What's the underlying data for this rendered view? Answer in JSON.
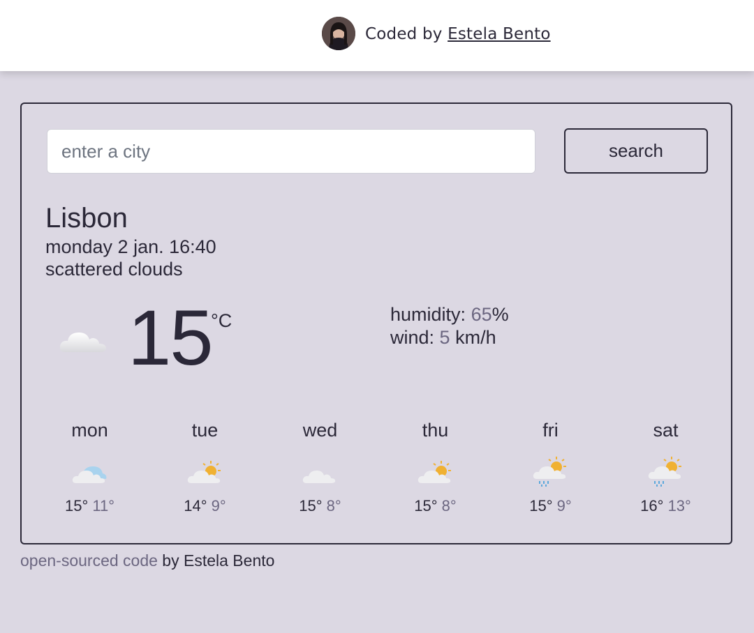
{
  "header": {
    "credit_prefix": "Coded by",
    "author_link": "Estela Bento"
  },
  "search": {
    "placeholder": "enter a city",
    "button_label": "search"
  },
  "current": {
    "city": "Lisbon",
    "date": "monday 2 jan. 16:40",
    "description": "scattered clouds",
    "icon": "cloud-icon",
    "temperature": "15",
    "unit": "°C",
    "humidity_label": "humidity:",
    "humidity_value": "65",
    "humidity_unit": "%",
    "wind_label": "wind:",
    "wind_value": "5",
    "wind_unit": "km/h"
  },
  "forecast": [
    {
      "day": "mon",
      "icon": "cloud-blue-icon",
      "max": "15°",
      "min": "11°"
    },
    {
      "day": "tue",
      "icon": "sun-cloud-icon",
      "max": "14°",
      "min": "9°"
    },
    {
      "day": "wed",
      "icon": "cloud-icon",
      "max": "15°",
      "min": "8°"
    },
    {
      "day": "thu",
      "icon": "sun-cloud-icon",
      "max": "15°",
      "min": "8°"
    },
    {
      "day": "fri",
      "icon": "sun-rain-icon",
      "max": "15°",
      "min": "9°"
    },
    {
      "day": "sat",
      "icon": "sun-rain-icon",
      "max": "16°",
      "min": "13°"
    }
  ],
  "footer": {
    "link_text": "open-sourced code",
    "suffix": " by Estela Bento"
  },
  "colors": {
    "background": "#dcd8e3",
    "text": "#2b2838",
    "muted": "#6b6680",
    "sun": "#f0b132"
  }
}
